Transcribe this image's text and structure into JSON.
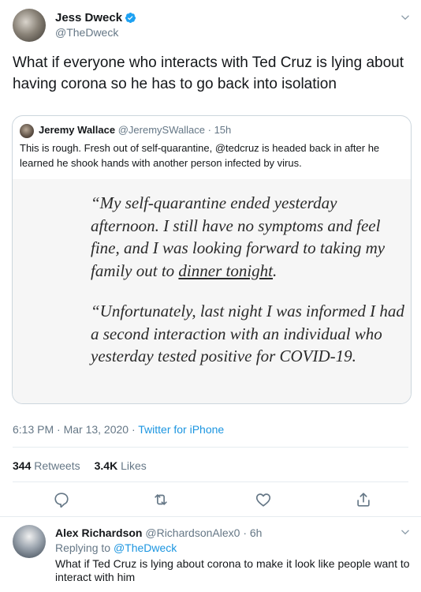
{
  "author": {
    "name": "Jess Dweck",
    "handle": "@TheDweck"
  },
  "tweet": {
    "text": "What if everyone who interacts with Ted Cruz is lying about having corona so he has to go back into isolation"
  },
  "quoted": {
    "name": "Jeremy Wallace",
    "handle": "@JeremySWallace",
    "sep": "·",
    "time": "15h",
    "text": "This is rough. Fresh out of self-quarantine, @tedcruz is headed back in after he learned he shook hands with another person infected by virus.",
    "image_para1_lead": "“My self-quarantine ended yesterday afternoon. I still have no symptoms and feel fine, and I was looking forward to taking my family out to ",
    "image_para1_link": "dinner tonight",
    "image_para1_tail": ".",
    "image_para2": "“Unfortunately, last night I was informed I had a second interaction with an individual who yesterday tested positive for COVID-19."
  },
  "meta": {
    "time": "6:13 PM · Mar 13, 2020 · ",
    "source": "Twitter for iPhone"
  },
  "stats": {
    "retweets_count": "344",
    "retweets_label": "Retweets",
    "likes_count": "3.4K",
    "likes_label": "Likes"
  },
  "reply": {
    "name": "Alex Richardson",
    "handle": "@RichardsonAlex0",
    "sep": "·",
    "time": "6h",
    "replying_prefix": "Replying to ",
    "replying_to": "@TheDweck",
    "text": "What if Ted Cruz is lying about corona to make it look like people want to interact with him"
  },
  "icons": {
    "verified": "verified-badge-icon",
    "caret": "chevron-down-icon",
    "reply": "reply-icon",
    "retweet": "retweet-icon",
    "like": "heart-icon",
    "share": "share-icon"
  },
  "colors": {
    "accent": "#1b95e0",
    "secondary_text": "#657786",
    "border": "#e6ecf0"
  }
}
